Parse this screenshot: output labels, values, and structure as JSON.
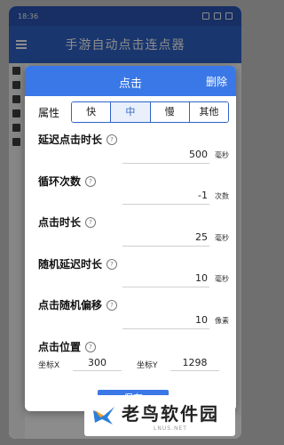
{
  "status_bar": {
    "time": "18:36"
  },
  "app": {
    "title": "手游自动点击连点器"
  },
  "dialog": {
    "title": "点击",
    "delete_label": "删除",
    "attribute_label": "属性",
    "attribute_options": [
      "快",
      "中",
      "慢",
      "其他"
    ],
    "attribute_selected": "中",
    "fields": [
      {
        "label": "延迟点击时长",
        "value": "500",
        "unit": "毫秒"
      },
      {
        "label": "循环次数",
        "value": "-1",
        "unit": "次数"
      },
      {
        "label": "点击时长",
        "value": "25",
        "unit": "毫秒"
      },
      {
        "label": "随机延迟时长",
        "value": "10",
        "unit": "毫秒"
      },
      {
        "label": "点击随机偏移",
        "value": "10",
        "unit": "像素"
      }
    ],
    "position": {
      "label": "点击位置",
      "x_label": "坐标X",
      "x_value": "300",
      "y_label": "坐标Y",
      "y_value": "1298"
    },
    "save_label": "保存"
  },
  "watermark": {
    "title": "老鸟软件园",
    "subtitle": "LNUS.NET"
  }
}
